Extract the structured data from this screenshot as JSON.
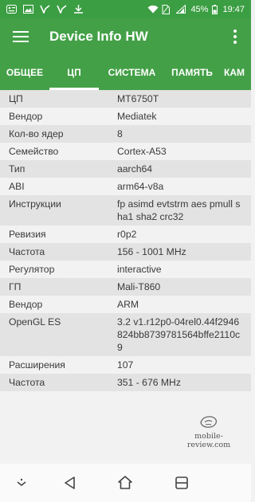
{
  "status_bar": {
    "battery": "45%",
    "time": "19:47"
  },
  "app_bar": {
    "title": "Device Info HW",
    "menu_icon": "hamburger-icon",
    "overflow_icon": "more-vert-icon"
  },
  "tabs": [
    {
      "label": "ОБЩЕЕ"
    },
    {
      "label": "ЦП"
    },
    {
      "label": "СИСТЕМА"
    },
    {
      "label": "ПАМЯТЬ"
    },
    {
      "label": "КАМ"
    }
  ],
  "active_tab": "ЦП",
  "rows": [
    {
      "label": "ЦП",
      "value": "MT6750T"
    },
    {
      "label": "Вендор",
      "value": "Mediatek"
    },
    {
      "label": "Кол-во ядер",
      "value": "8"
    },
    {
      "label": "Семейство",
      "value": "Cortex-A53"
    },
    {
      "label": "Тип",
      "value": "aarch64"
    },
    {
      "label": "ABI",
      "value": "arm64-v8a"
    },
    {
      "label": "Инструкции",
      "value": "fp asimd evtstrm aes pmull sha1 sha2 crc32"
    },
    {
      "label": "Ревизия",
      "value": "r0p2"
    },
    {
      "label": "Частота",
      "value": "156 - 1001 MHz"
    },
    {
      "label": "Регулятор",
      "value": "interactive"
    },
    {
      "label": "ГП",
      "value": "Mali-T860"
    },
    {
      "label": "Вендор",
      "value": "ARM"
    },
    {
      "label": "OpenGL ES",
      "value": "3.2 v1.r12p0-04rel0.44f2946824bb8739781564bffe2110c9"
    },
    {
      "label": "Расширения",
      "value": "107"
    },
    {
      "label": "Частота",
      "value": "351 - 676 MHz"
    }
  ],
  "watermark": {
    "text": "mobile-review.com"
  },
  "colors": {
    "primary": "#43a047",
    "status_bar": "#3b9e42",
    "accent": "#ffffff"
  }
}
